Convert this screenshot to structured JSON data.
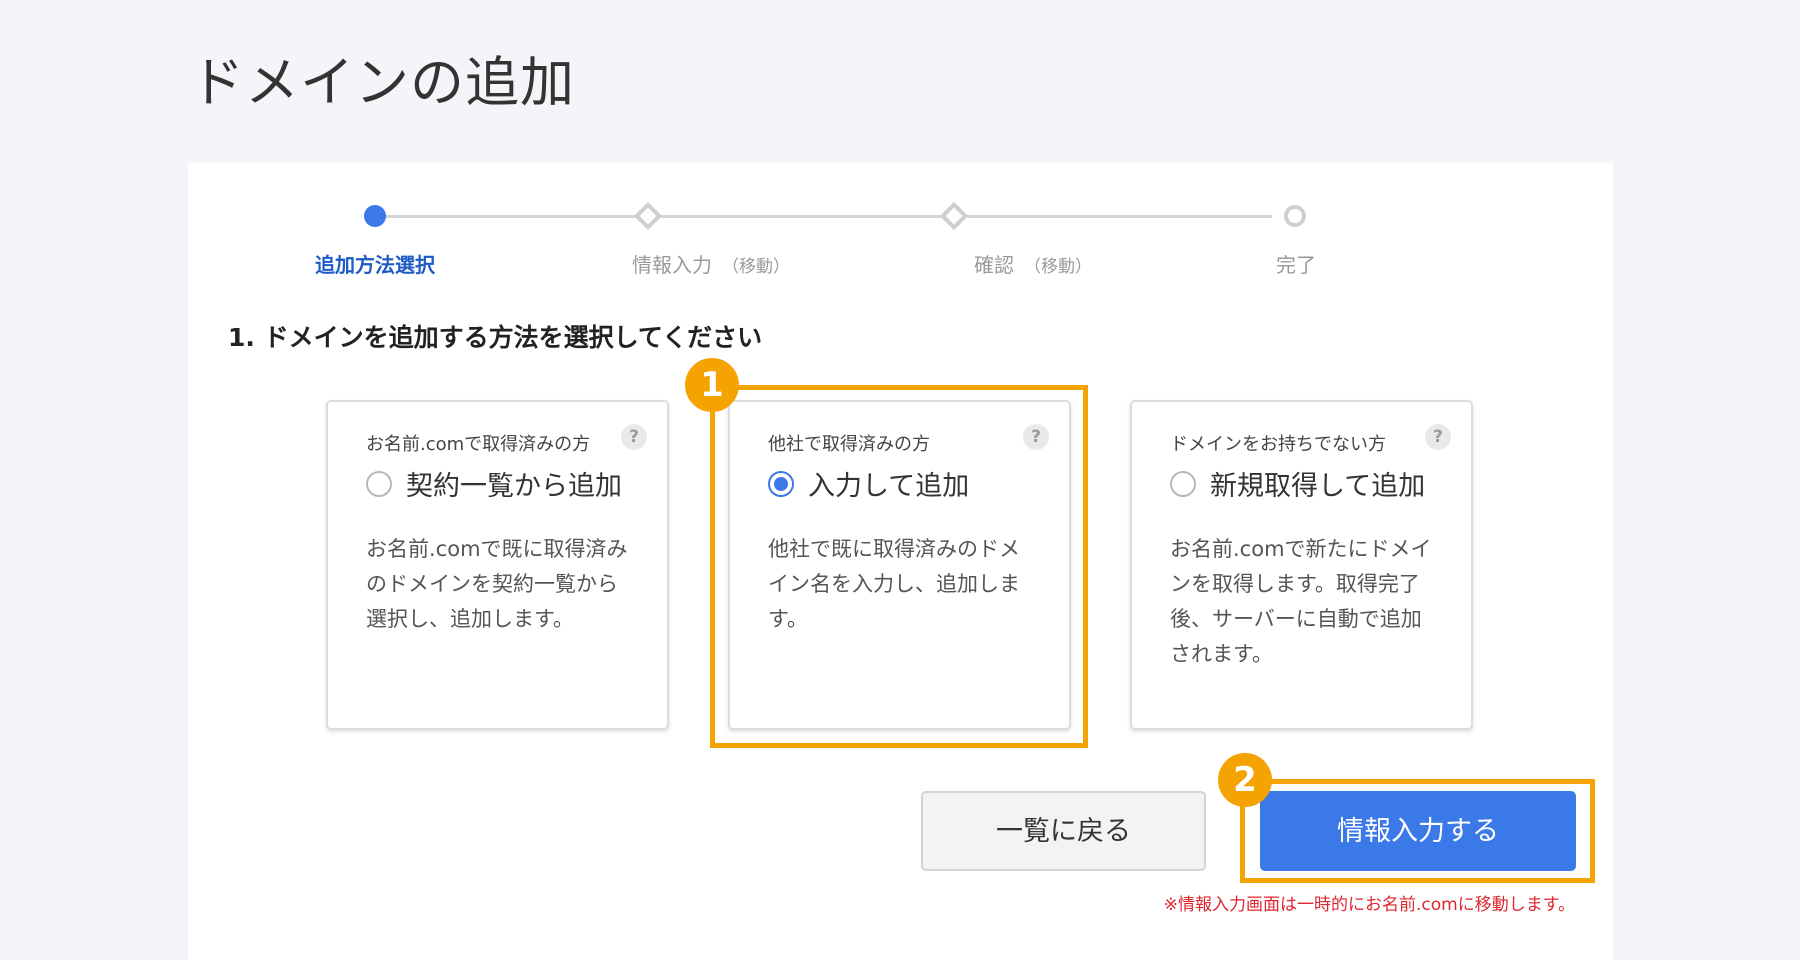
{
  "page": {
    "title": "ドメインの追加"
  },
  "stepper": {
    "steps": [
      {
        "label": "追加方法選択",
        "sub": "",
        "state": "active"
      },
      {
        "label": "情報入力",
        "sub": "（移動）",
        "state": "pending"
      },
      {
        "label": "確認",
        "sub": "（移動）",
        "state": "pending"
      },
      {
        "label": "完了",
        "sub": "",
        "state": "pending"
      }
    ]
  },
  "section": {
    "heading": "1. ドメインを追加する方法を選択してください"
  },
  "options": [
    {
      "caption": "お名前.comで取得済みの方",
      "label": "契約一覧から追加",
      "description": "お名前.comで既に取得済みのドメインを契約一覧から選択し、追加します。",
      "selected": false,
      "help": "?"
    },
    {
      "caption": "他社で取得済みの方",
      "label": "入力して追加",
      "description": "他社で既に取得済みのドメイン名を入力し、追加します。",
      "selected": true,
      "help": "?"
    },
    {
      "caption": "ドメインをお持ちでない方",
      "label": "新規取得して追加",
      "description": "お名前.comで新たにドメインを取得します。取得完了後、サーバーに自動で追加されます。",
      "selected": false,
      "help": "?"
    }
  ],
  "annotations": {
    "badge1": "1",
    "badge2": "2"
  },
  "buttons": {
    "back": "一覧に戻る",
    "next": "情報入力する"
  },
  "note": "※情報入力画面は一時的にお名前.comに移動します。",
  "colors": {
    "accent": "#3b79e8",
    "highlight": "#f5a300",
    "note": "#e0262f"
  }
}
